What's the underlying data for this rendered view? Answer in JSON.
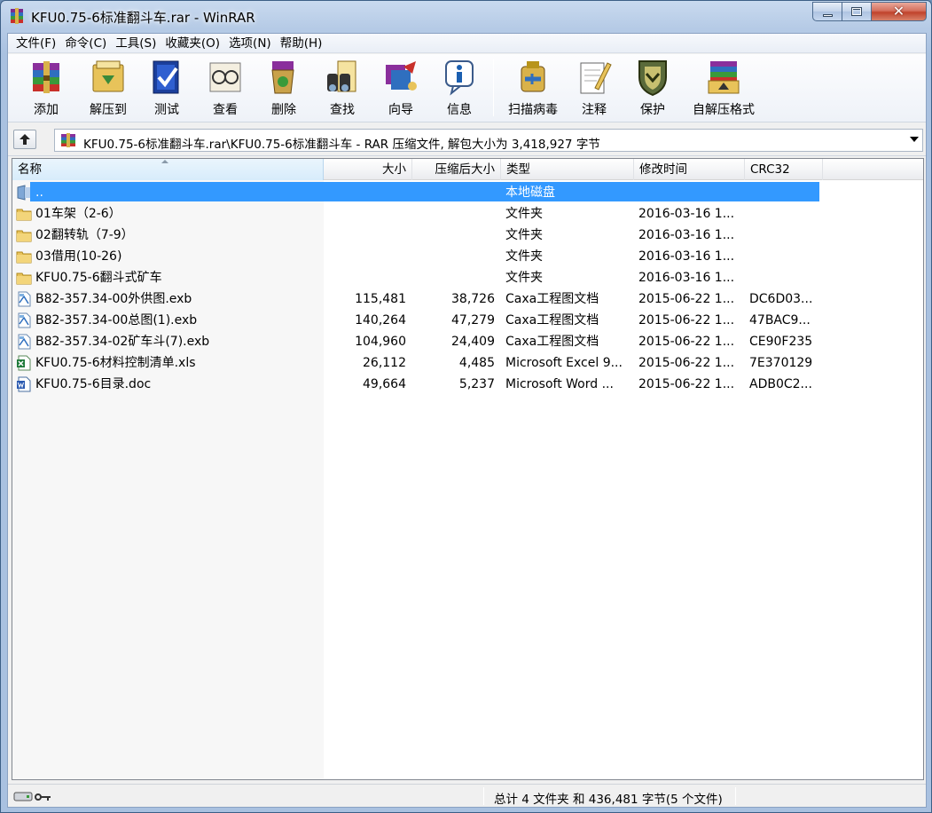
{
  "window": {
    "title": "KFU0.75-6标准翻斗车.rar - WinRAR"
  },
  "menu": [
    {
      "label": "文件(F)"
    },
    {
      "label": "命令(C)"
    },
    {
      "label": "工具(S)"
    },
    {
      "label": "收藏夹(O)"
    },
    {
      "label": "选项(N)"
    },
    {
      "label": "帮助(H)"
    }
  ],
  "toolbar": [
    {
      "label": "添加",
      "icon": "add-archive-icon"
    },
    {
      "label": "解压到",
      "icon": "extract-to-icon"
    },
    {
      "label": "测试",
      "icon": "test-icon"
    },
    {
      "label": "查看",
      "icon": "view-icon"
    },
    {
      "label": "删除",
      "icon": "delete-icon"
    },
    {
      "label": "查找",
      "icon": "find-icon"
    },
    {
      "label": "向导",
      "icon": "wizard-icon"
    },
    {
      "label": "信息",
      "icon": "info-icon"
    },
    {
      "label": "扫描病毒",
      "icon": "virus-scan-icon"
    },
    {
      "label": "注释",
      "icon": "comment-icon"
    },
    {
      "label": "保护",
      "icon": "protect-icon"
    },
    {
      "label": "自解压格式",
      "icon": "sfx-icon"
    }
  ],
  "address": {
    "path": "KFU0.75-6标准翻斗车.rar\\KFU0.75-6标准翻斗车 - RAR 压缩文件, 解包大小为 3,418,927 字节"
  },
  "columns": {
    "name": "名称",
    "size": "大小",
    "packed": "压缩后大小",
    "type": "类型",
    "modified": "修改时间",
    "crc": "CRC32"
  },
  "files": [
    {
      "name": "..",
      "size": "",
      "packed": "",
      "type": "本地磁盘",
      "modified": "",
      "crc": "",
      "icon": "parent-folder-icon",
      "selected": true
    },
    {
      "name": "01车架（2-6）",
      "size": "",
      "packed": "",
      "type": "文件夹",
      "modified": "2016-03-16 1...",
      "crc": "",
      "icon": "folder-icon"
    },
    {
      "name": "02翻转轨（7-9）",
      "size": "",
      "packed": "",
      "type": "文件夹",
      "modified": "2016-03-16 1...",
      "crc": "",
      "icon": "folder-icon"
    },
    {
      "name": "03借用(10-26)",
      "size": "",
      "packed": "",
      "type": "文件夹",
      "modified": "2016-03-16 1...",
      "crc": "",
      "icon": "folder-icon"
    },
    {
      "name": "KFU0.75-6翻斗式矿车",
      "size": "",
      "packed": "",
      "type": "文件夹",
      "modified": "2016-03-16 1...",
      "crc": "",
      "icon": "folder-icon"
    },
    {
      "name": "B82-357.34-00外供图.exb",
      "size": "115,481",
      "packed": "38,726",
      "type": "Caxa工程图文档",
      "modified": "2015-06-22 1...",
      "crc": "DC6D03...",
      "icon": "caxa-file-icon"
    },
    {
      "name": "B82-357.34-00总图(1).exb",
      "size": "140,264",
      "packed": "47,279",
      "type": "Caxa工程图文档",
      "modified": "2015-06-22 1...",
      "crc": "47BAC9...",
      "icon": "caxa-file-icon"
    },
    {
      "name": "B82-357.34-02矿车斗(7).exb",
      "size": "104,960",
      "packed": "24,409",
      "type": "Caxa工程图文档",
      "modified": "2015-06-22 1...",
      "crc": "CE90F235",
      "icon": "caxa-file-icon"
    },
    {
      "name": "KFU0.75-6材料控制清单.xls",
      "size": "26,112",
      "packed": "4,485",
      "type": "Microsoft Excel 9...",
      "modified": "2015-06-22 1...",
      "crc": "7E370129",
      "icon": "excel-file-icon"
    },
    {
      "name": "KFU0.75-6目录.doc",
      "size": "49,664",
      "packed": "5,237",
      "type": "Microsoft Word ...",
      "modified": "2015-06-22 1...",
      "crc": "ADB0C2...",
      "icon": "word-file-icon"
    }
  ],
  "status": {
    "summary": "总计 4 文件夹 和 436,481 字节(5 个文件)"
  }
}
